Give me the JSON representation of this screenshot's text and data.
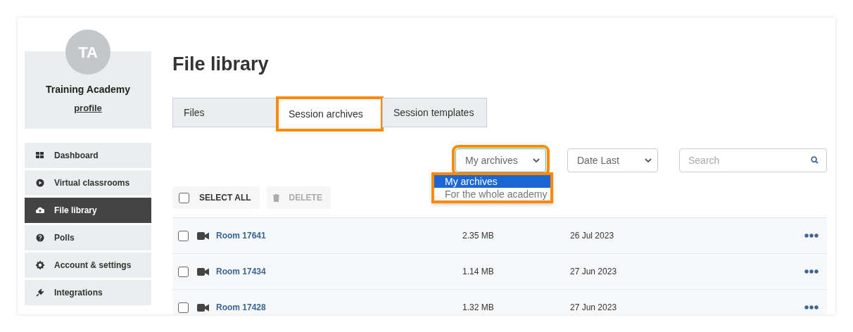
{
  "profile": {
    "initials": "TA",
    "name": "Training Academy",
    "link": "profile"
  },
  "sidebar": {
    "items": [
      {
        "label": "Dashboard",
        "selected": false
      },
      {
        "label": "Virtual classrooms",
        "selected": false
      },
      {
        "label": "File library",
        "selected": true
      },
      {
        "label": "Polls",
        "selected": false
      },
      {
        "label": "Account & settings",
        "selected": false
      },
      {
        "label": "Integrations",
        "selected": false
      }
    ]
  },
  "page_title": "File library",
  "tabs": [
    {
      "label": "Files",
      "selected": false,
      "highlighted": false
    },
    {
      "label": "Session archives",
      "selected": true,
      "highlighted": true
    },
    {
      "label": "Session templates",
      "selected": false,
      "highlighted": false
    }
  ],
  "filters": {
    "owner": {
      "value": "My archives",
      "expanded": true,
      "highlighted": true,
      "options": [
        {
          "label": "My archives",
          "selected": true
        },
        {
          "label": "For the whole academy",
          "selected": false
        }
      ]
    },
    "sort": {
      "value": "Date Last"
    },
    "search": {
      "placeholder": "Search"
    }
  },
  "toolbar": {
    "select_all": {
      "label": "SELECT ALL",
      "checked": false
    },
    "delete": {
      "label": "DELETE",
      "disabled": true
    }
  },
  "rows": [
    {
      "name": "Room 17641",
      "size": "2.35 MB",
      "date": "26 Jul 2023",
      "checked": false
    },
    {
      "name": "Room 17434",
      "size": "1.14 MB",
      "date": "27 Jun 2023",
      "checked": false
    },
    {
      "name": "Room 17428",
      "size": "1.32 MB",
      "date": "27 Jun 2023",
      "checked": false
    }
  ]
}
